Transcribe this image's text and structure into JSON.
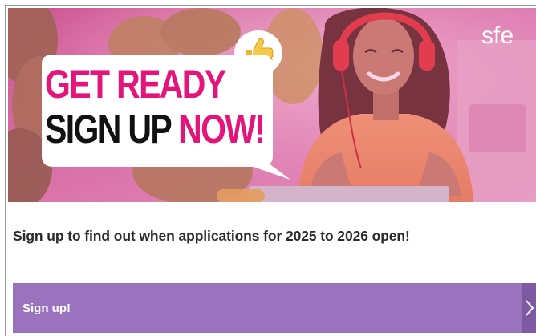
{
  "banner": {
    "brand_logo": "sfe",
    "bubble_line1": "GET READY",
    "bubble_line2_a": "SIGN UP",
    "bubble_line2_b": "NOW!",
    "reaction_icon": "thumbs-up-icon",
    "colors": {
      "overlay": "#e44b9a",
      "headline_pink": "#e5147a",
      "headline_black": "#111111"
    }
  },
  "content": {
    "headline": "Sign up to find out when applications for 2025 to 2026 open!"
  },
  "cta": {
    "label": "Sign up!",
    "arrow_icon": "chevron-right-icon",
    "color": "#9b72bd"
  }
}
